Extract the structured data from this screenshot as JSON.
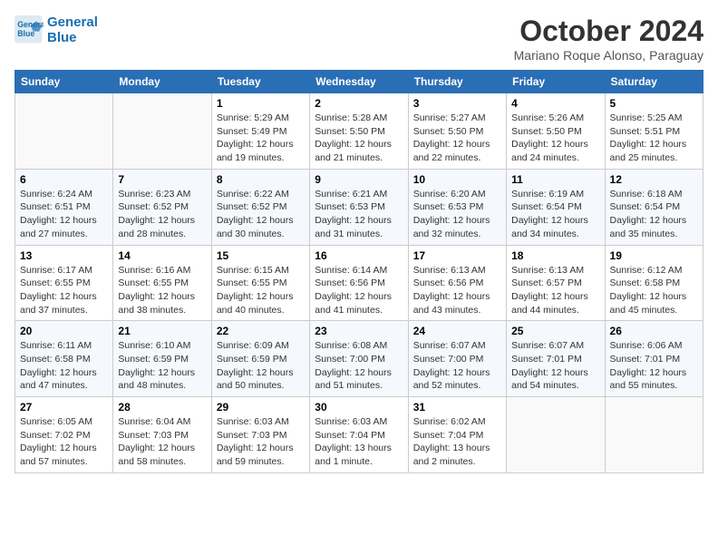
{
  "header": {
    "logo_line1": "General",
    "logo_line2": "Blue",
    "month_title": "October 2024",
    "location": "Mariano Roque Alonso, Paraguay"
  },
  "weekdays": [
    "Sunday",
    "Monday",
    "Tuesday",
    "Wednesday",
    "Thursday",
    "Friday",
    "Saturday"
  ],
  "weeks": [
    [
      {
        "day": "",
        "info": ""
      },
      {
        "day": "",
        "info": ""
      },
      {
        "day": "1",
        "info": "Sunrise: 5:29 AM\nSunset: 5:49 PM\nDaylight: 12 hours and 19 minutes."
      },
      {
        "day": "2",
        "info": "Sunrise: 5:28 AM\nSunset: 5:50 PM\nDaylight: 12 hours and 21 minutes."
      },
      {
        "day": "3",
        "info": "Sunrise: 5:27 AM\nSunset: 5:50 PM\nDaylight: 12 hours and 22 minutes."
      },
      {
        "day": "4",
        "info": "Sunrise: 5:26 AM\nSunset: 5:50 PM\nDaylight: 12 hours and 24 minutes."
      },
      {
        "day": "5",
        "info": "Sunrise: 5:25 AM\nSunset: 5:51 PM\nDaylight: 12 hours and 25 minutes."
      }
    ],
    [
      {
        "day": "6",
        "info": "Sunrise: 6:24 AM\nSunset: 6:51 PM\nDaylight: 12 hours and 27 minutes."
      },
      {
        "day": "7",
        "info": "Sunrise: 6:23 AM\nSunset: 6:52 PM\nDaylight: 12 hours and 28 minutes."
      },
      {
        "day": "8",
        "info": "Sunrise: 6:22 AM\nSunset: 6:52 PM\nDaylight: 12 hours and 30 minutes."
      },
      {
        "day": "9",
        "info": "Sunrise: 6:21 AM\nSunset: 6:53 PM\nDaylight: 12 hours and 31 minutes."
      },
      {
        "day": "10",
        "info": "Sunrise: 6:20 AM\nSunset: 6:53 PM\nDaylight: 12 hours and 32 minutes."
      },
      {
        "day": "11",
        "info": "Sunrise: 6:19 AM\nSunset: 6:54 PM\nDaylight: 12 hours and 34 minutes."
      },
      {
        "day": "12",
        "info": "Sunrise: 6:18 AM\nSunset: 6:54 PM\nDaylight: 12 hours and 35 minutes."
      }
    ],
    [
      {
        "day": "13",
        "info": "Sunrise: 6:17 AM\nSunset: 6:55 PM\nDaylight: 12 hours and 37 minutes."
      },
      {
        "day": "14",
        "info": "Sunrise: 6:16 AM\nSunset: 6:55 PM\nDaylight: 12 hours and 38 minutes."
      },
      {
        "day": "15",
        "info": "Sunrise: 6:15 AM\nSunset: 6:55 PM\nDaylight: 12 hours and 40 minutes."
      },
      {
        "day": "16",
        "info": "Sunrise: 6:14 AM\nSunset: 6:56 PM\nDaylight: 12 hours and 41 minutes."
      },
      {
        "day": "17",
        "info": "Sunrise: 6:13 AM\nSunset: 6:56 PM\nDaylight: 12 hours and 43 minutes."
      },
      {
        "day": "18",
        "info": "Sunrise: 6:13 AM\nSunset: 6:57 PM\nDaylight: 12 hours and 44 minutes."
      },
      {
        "day": "19",
        "info": "Sunrise: 6:12 AM\nSunset: 6:58 PM\nDaylight: 12 hours and 45 minutes."
      }
    ],
    [
      {
        "day": "20",
        "info": "Sunrise: 6:11 AM\nSunset: 6:58 PM\nDaylight: 12 hours and 47 minutes."
      },
      {
        "day": "21",
        "info": "Sunrise: 6:10 AM\nSunset: 6:59 PM\nDaylight: 12 hours and 48 minutes."
      },
      {
        "day": "22",
        "info": "Sunrise: 6:09 AM\nSunset: 6:59 PM\nDaylight: 12 hours and 50 minutes."
      },
      {
        "day": "23",
        "info": "Sunrise: 6:08 AM\nSunset: 7:00 PM\nDaylight: 12 hours and 51 minutes."
      },
      {
        "day": "24",
        "info": "Sunrise: 6:07 AM\nSunset: 7:00 PM\nDaylight: 12 hours and 52 minutes."
      },
      {
        "day": "25",
        "info": "Sunrise: 6:07 AM\nSunset: 7:01 PM\nDaylight: 12 hours and 54 minutes."
      },
      {
        "day": "26",
        "info": "Sunrise: 6:06 AM\nSunset: 7:01 PM\nDaylight: 12 hours and 55 minutes."
      }
    ],
    [
      {
        "day": "27",
        "info": "Sunrise: 6:05 AM\nSunset: 7:02 PM\nDaylight: 12 hours and 57 minutes."
      },
      {
        "day": "28",
        "info": "Sunrise: 6:04 AM\nSunset: 7:03 PM\nDaylight: 12 hours and 58 minutes."
      },
      {
        "day": "29",
        "info": "Sunrise: 6:03 AM\nSunset: 7:03 PM\nDaylight: 12 hours and 59 minutes."
      },
      {
        "day": "30",
        "info": "Sunrise: 6:03 AM\nSunset: 7:04 PM\nDaylight: 13 hours and 1 minute."
      },
      {
        "day": "31",
        "info": "Sunrise: 6:02 AM\nSunset: 7:04 PM\nDaylight: 13 hours and 2 minutes."
      },
      {
        "day": "",
        "info": ""
      },
      {
        "day": "",
        "info": ""
      }
    ]
  ]
}
